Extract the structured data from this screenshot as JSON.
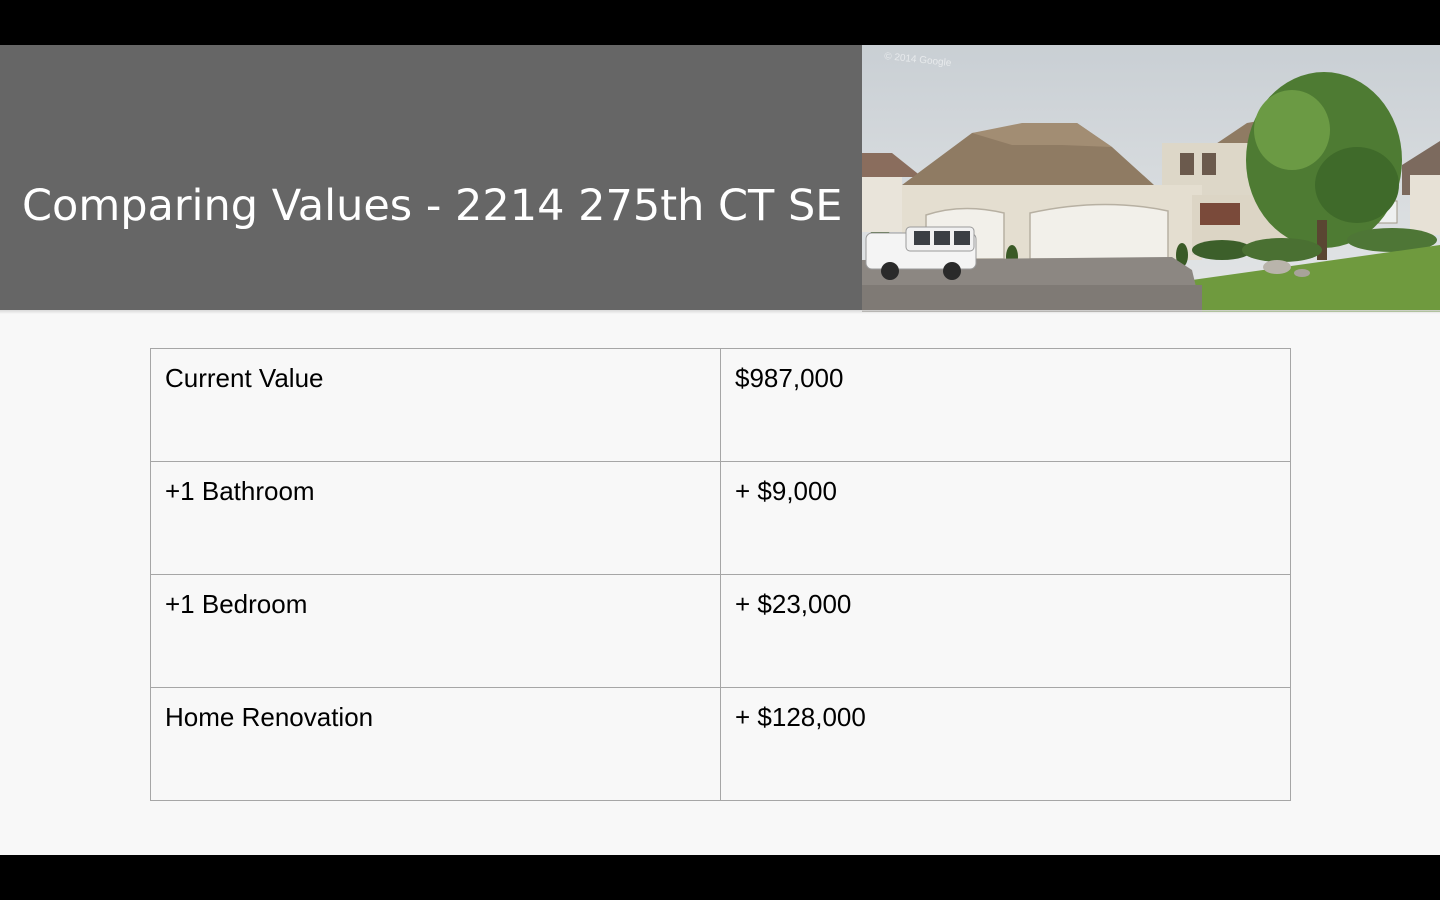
{
  "slide": {
    "title": "Comparing Values - 2214 275th CT SE",
    "photo": {
      "icon": "house-photo",
      "watermark": "© 2014 Google"
    }
  },
  "table": {
    "rows": [
      {
        "label": "Current Value",
        "value": "$987,000"
      },
      {
        "label": "+1 Bathroom",
        "value": "+ $9,000"
      },
      {
        "label": "+1 Bedroom",
        "value": "+ $23,000"
      },
      {
        "label": "Home Renovation",
        "value": "+ $128,000"
      }
    ]
  },
  "colors": {
    "title_band": "#666666",
    "slide_background": "#f8f8f8",
    "table_border": "#a6a6a6",
    "letterbox": "#000000"
  }
}
